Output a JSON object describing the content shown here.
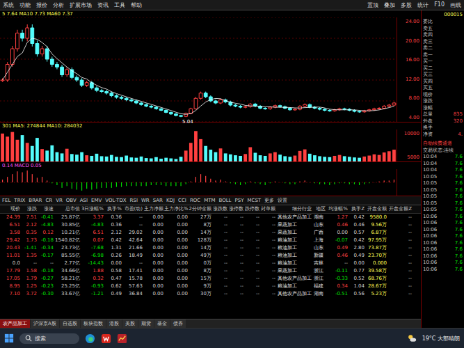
{
  "menu": [
    "系统",
    "功能",
    "报价",
    "分析",
    "扩展市场",
    "资讯",
    "工具",
    "帮助"
  ],
  "toolbar": [
    "置顶",
    "叠加",
    "多股",
    "统计",
    "F10",
    "画线"
  ],
  "chart": {
    "price_legend": "5 7.64 MA10 7.73 MA60 7.37",
    "low_label": "5.04",
    "price_ticks": [
      "24.00",
      "20.00",
      "16.00",
      "12.00",
      "8.00",
      "4.00"
    ],
    "price": [
      12,
      15,
      18,
      21,
      20,
      22,
      19,
      17,
      18,
      16,
      15,
      14.5,
      13,
      14,
      12.5,
      12,
      11,
      11.5,
      10.5,
      10,
      9.8,
      9.5,
      9,
      8.7,
      8.5,
      8.2,
      8,
      7.6,
      7.3,
      7,
      6.8,
      6.5,
      6.2,
      5.8,
      5.5,
      5.2,
      5.04,
      5.6,
      6.5,
      8.5,
      9.5,
      8.8,
      8,
      7.6,
      8.2,
      7.8,
      7.2,
      7,
      6.8,
      6.9,
      7.4,
      7,
      6.6,
      6.5,
      6.8,
      7.1,
      6.9,
      6.6,
      6.3,
      6.4,
      7,
      7.3,
      6.8,
      6.6,
      6.4,
      6.2,
      6.1,
      6.3,
      6.5,
      6.4,
      6.2,
      6,
      5.9,
      6.1,
      6.3,
      6.5,
      6.6,
      7,
      7.2,
      7.6
    ],
    "volume_legend": "301 MA5: 274844 MA10: 284032",
    "volume_ticks": [
      "10000",
      "5000"
    ],
    "volume": [
      9000,
      8000,
      9500,
      7000,
      8500,
      6000,
      5000,
      7600,
      4000,
      3500,
      5200,
      3000,
      2600,
      4100,
      2400,
      2200,
      3000,
      2000,
      1800,
      2500,
      1700,
      1600,
      2100,
      1500,
      1400,
      1900,
      1300,
      1200,
      1600,
      1100,
      1000,
      1400,
      900,
      1200,
      1000,
      800,
      1500,
      3500,
      6000,
      9800,
      7200,
      5000,
      3800,
      3000,
      4200,
      2600,
      2300,
      2000,
      1800,
      2400,
      4600,
      2800,
      2000,
      1800,
      2600,
      3000,
      2200,
      1700,
      1500,
      1900,
      3400,
      3900,
      2500,
      2000,
      1700,
      1500,
      1400,
      1800,
      2100,
      1700,
      1500,
      1300,
      1200,
      1600,
      1900,
      2300,
      2100,
      2900,
      3300,
      3800
    ],
    "macd_legend": "0.14 MACD 0.05",
    "macd": [
      0.3,
      0.6,
      0.9,
      1.2,
      1.1,
      1.3,
      0.9,
      0.5,
      0.6,
      0.2,
      -0.1,
      -0.3,
      -0.6,
      -0.4,
      -0.7,
      -0.8,
      -0.9,
      -0.7,
      -0.8,
      -0.7,
      -0.6,
      -0.6,
      -0.6,
      -0.5,
      -0.5,
      -0.4,
      -0.4,
      -0.4,
      -0.4,
      -0.4,
      -0.3,
      -0.3,
      -0.3,
      -0.4,
      -0.4,
      -0.4,
      -0.4,
      -0.2,
      0.1,
      0.6,
      0.9,
      0.7,
      0.4,
      0.2,
      0.3,
      0.1,
      -0.1,
      -0.2,
      -0.3,
      -0.2,
      0.1,
      -0.1,
      -0.2,
      -0.3,
      -0.1,
      0.1,
      0,
      -0.1,
      -0.2,
      -0.2,
      0.1,
      0.2,
      0,
      -0.1,
      -0.2,
      -0.2,
      -0.3,
      -0.2,
      -0.1,
      -0.1,
      -0.2,
      -0.2,
      -0.3,
      -0.2,
      -0.1,
      0,
      0.1,
      0.2,
      0.2,
      0.3
    ]
  },
  "indicator_tabs": [
    {
      "label": "FEL",
      "selected": false
    },
    {
      "label": "TRIX",
      "selected": false
    },
    {
      "label": "BRAR",
      "selected": false
    },
    {
      "label": "CR",
      "selected": false
    },
    {
      "label": "VR",
      "selected": false
    },
    {
      "label": "OBV",
      "selected": false
    },
    {
      "label": "ASI",
      "selected": false
    },
    {
      "label": "EMV",
      "selected": false
    },
    {
      "label": "VOL-TDX",
      "selected": false
    },
    {
      "label": "RSI",
      "selected": false
    },
    {
      "label": "WR",
      "selected": false
    },
    {
      "label": "SAR",
      "selected": false
    },
    {
      "label": "KDJ",
      "selected": false
    },
    {
      "label": "CCI",
      "selected": false
    },
    {
      "label": "ROC",
      "selected": false
    },
    {
      "label": "MTM",
      "selected": false
    },
    {
      "label": "BOLL",
      "selected": false
    },
    {
      "label": "PSY",
      "selected": false
    },
    {
      "label": "MCST",
      "selected": false
    },
    {
      "label": "更多",
      "selected": false
    },
    {
      "label": "设置",
      "selected": false
    }
  ],
  "table": {
    "columns": [
      {
        "label": "现价",
        "kind": "signed"
      },
      {
        "label": "涨跌",
        "kind": "signed"
      },
      {
        "label": "涨速",
        "kind": "signed"
      },
      {
        "label": "总市值",
        "kind": "plain"
      },
      {
        "label": "3日涨幅%",
        "kind": "signed"
      },
      {
        "label": "换手%",
        "kind": "plain"
      },
      {
        "label": "市盈(动)",
        "kind": "plain"
      },
      {
        "label": "主力净额",
        "kind": "plain"
      },
      {
        "label": "主力净比%",
        "kind": "plain"
      },
      {
        "label": "2分钟金额",
        "kind": "plain"
      },
      {
        "label": "涨跌数",
        "kind": "plain"
      },
      {
        "label": "涨停数",
        "kind": "plain"
      },
      {
        "label": "跌停数",
        "kind": "plain"
      },
      {
        "label": "封单额",
        "kind": "plain"
      },
      {
        "label": "细分行业",
        "kind": "text"
      },
      {
        "label": "地区",
        "kind": "text"
      },
      {
        "label": "均涨幅%",
        "kind": "signed"
      },
      {
        "label": "换手Z",
        "kind": "plain"
      },
      {
        "label": "开盘金额",
        "kind": "money"
      },
      {
        "label": "开盘金额Z",
        "kind": "plain"
      }
    ],
    "rows": [
      [
        "24.39",
        "7.51",
        "-0.41",
        "25.87亿",
        "3.37",
        "0.36",
        "--",
        "0.00",
        "0.00",
        "27万",
        "--",
        "--",
        "--",
        "--",
        "其他农产品加工",
        "湖南",
        "1.27",
        "0.42",
        "9580.0",
        "--"
      ],
      [
        "6.51",
        "2.12",
        "-4.83",
        "30.85亿",
        "-4.83",
        "0.36",
        "--",
        "0.00",
        "0.00",
        "8万",
        "--",
        "--",
        "--",
        "--",
        "果蔬加工",
        "山东",
        "0.46",
        "0.46",
        "9.56万",
        "--"
      ],
      [
        "3.58",
        "0.35",
        "0.12",
        "10.21亿",
        "6.51",
        "2.12",
        "29.02",
        "0.00",
        "0.00",
        "14万",
        "--",
        "--",
        "--",
        "--",
        "果蔬加工",
        "广西",
        "0.00",
        "0.57",
        "6.87万",
        "--"
      ],
      [
        "29.42",
        "1.73",
        "-0.18",
        "1540.82亿",
        "0.07",
        "0.42",
        "42.64",
        "0.00",
        "0.00",
        "128万",
        "--",
        "--",
        "--",
        "--",
        "粮油加工",
        "上海",
        "-0.07",
        "0.42",
        "97.95万",
        "--"
      ],
      [
        "20.43",
        "-1.41",
        "-0.34",
        "23.73亿",
        "-7.68",
        "1.31",
        "21.66",
        "0.00",
        "0.00",
        "14万",
        "--",
        "--",
        "--",
        "--",
        "粮油加工",
        "山东",
        "0.49",
        "2.80",
        "73.87万",
        "--"
      ],
      [
        "11.01",
        "1.35",
        "-0.17",
        "85.55亿",
        "-6.98",
        "0.26",
        "18.49",
        "0.00",
        "0.00",
        "49万",
        "--",
        "--",
        "--",
        "--",
        "粮油加工",
        "新疆",
        "0.46",
        "0.49",
        "23.70万",
        "--"
      ],
      [
        "0.0",
        "--",
        "--",
        "2.77亿",
        "-14.43",
        "0.00",
        "--",
        "0.00",
        "0.00",
        "0万",
        "--",
        "--",
        "--",
        "--",
        "粮油加工",
        "吉林",
        "--",
        "0.00",
        "0.000",
        "--"
      ],
      [
        "17.79",
        "1.58",
        "-0.18",
        "34.66亿",
        "1.88",
        "0.58",
        "17.41",
        "0.00",
        "0.00",
        "8万",
        "--",
        "--",
        "--",
        "--",
        "果蔬加工",
        "浙江",
        "-0.11",
        "0.77",
        "39.58万",
        "--"
      ],
      [
        "17.05",
        "1.79",
        "-0.27",
        "58.21亿",
        "0.32",
        "0.47",
        "15.78",
        "0.00",
        "0.00",
        "15万",
        "--",
        "--",
        "--",
        "--",
        "其他农产品加工",
        "浙江",
        "-0.33",
        "0.52",
        "68.76万",
        "--"
      ],
      [
        "8.95",
        "1.25",
        "-0.23",
        "25.25亿",
        "-0.93",
        "0.62",
        "57.63",
        "0.00",
        "0.00",
        "9万",
        "--",
        "--",
        "--",
        "--",
        "粮油加工",
        "福建",
        "0.34",
        "1.04",
        "28.67万",
        "--"
      ],
      [
        "7.10",
        "3.72",
        "-0.30",
        "33.67亿",
        "-1.21",
        "0.49",
        "36.84",
        "0.00",
        "0.00",
        "30万",
        "--",
        "--",
        "--",
        "--",
        "其他农产品加工",
        "湖南",
        "-0.51",
        "0.56",
        "5.23万",
        "--"
      ]
    ]
  },
  "sheet_tabs": [
    {
      "label": "农产品加工",
      "selected": true
    },
    {
      "label": "沪深京A股",
      "selected": false
    },
    {
      "label": "自选股",
      "selected": false
    },
    {
      "label": "板块指数",
      "selected": false
    },
    {
      "label": "港股",
      "selected": false
    },
    {
      "label": "美股",
      "selected": false
    },
    {
      "label": "期货",
      "selected": false
    },
    {
      "label": "基金",
      "selected": false
    },
    {
      "label": "债券",
      "selected": false
    }
  ],
  "quote": {
    "code": "000015",
    "fields": [
      {
        "label": "委比",
        "value": ""
      },
      {
        "label": "卖五",
        "value": ""
      },
      {
        "label": "卖四",
        "value": ""
      },
      {
        "label": "卖三",
        "value": ""
      },
      {
        "label": "卖二",
        "value": ""
      },
      {
        "label": "卖一",
        "value": ""
      },
      {
        "label": "买一",
        "value": ""
      },
      {
        "label": "买二",
        "value": ""
      },
      {
        "label": "买三",
        "value": ""
      },
      {
        "label": "买四",
        "value": ""
      },
      {
        "label": "买五",
        "value": ""
      },
      {
        "label": "现价",
        "value": ""
      },
      {
        "label": "涨跌",
        "value": ""
      },
      {
        "label": "涨幅",
        "value": ""
      },
      {
        "label": "总量",
        "value": "835"
      },
      {
        "label": "外盘",
        "value": "320"
      },
      {
        "label": "换手",
        "value": ""
      },
      {
        "label": "净资",
        "value": "4."
      }
    ],
    "notice": "自动续费通道",
    "trade_state": "交易状态:连续"
  },
  "ticks": [
    {
      "time": "10:04",
      "price": "7.6"
    },
    {
      "time": "10:04",
      "price": "7.6"
    },
    {
      "time": "10:04",
      "price": "7.6"
    },
    {
      "time": "10:05",
      "price": "7.6"
    },
    {
      "time": "10:05",
      "price": "7.6"
    },
    {
      "time": "10:05",
      "price": "7.6"
    },
    {
      "time": "10:05",
      "price": "7.6"
    },
    {
      "time": "10:05",
      "price": "7.6"
    },
    {
      "time": "10:05",
      "price": "7.6"
    },
    {
      "time": "10:06",
      "price": "7.6"
    },
    {
      "time": "10:06",
      "price": "7.6"
    },
    {
      "time": "10:06",
      "price": "7.6"
    },
    {
      "time": "10:06",
      "price": "7.6"
    },
    {
      "time": "10:06",
      "price": "7.6"
    },
    {
      "time": "10:06",
      "price": "7.6"
    },
    {
      "time": "10:06",
      "price": "7.6"
    },
    {
      "time": "10:06",
      "price": "7.6"
    },
    {
      "time": "10:06",
      "price": "7.6"
    }
  ],
  "taskbar": {
    "search": "搜索",
    "weather": "19°C 大部晴朗"
  }
}
